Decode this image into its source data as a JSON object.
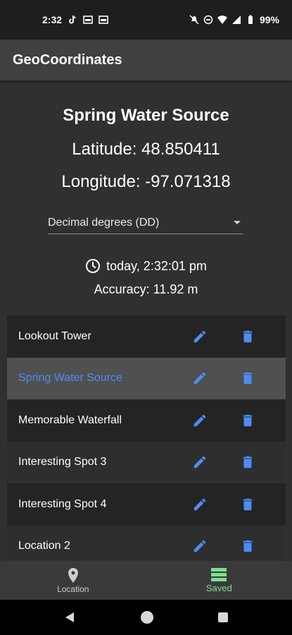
{
  "status_bar": {
    "time": "2:32",
    "battery": "99%"
  },
  "app_bar": {
    "title": "GeoCoordinates"
  },
  "location": {
    "name": "Spring Water Source",
    "latitude": "Latitude: 48.850411",
    "longitude": "Longitude: -97.071318",
    "format": "Decimal degrees (DD)",
    "timestamp": "today, 2:32:01 pm",
    "accuracy": "Accuracy: 11.92 m"
  },
  "saved_list": [
    {
      "label": "Lookout Tower"
    },
    {
      "label": "Spring Water Source",
      "selected": true
    },
    {
      "label": "Memorable Waterfall"
    },
    {
      "label": "Interesting Spot 3"
    },
    {
      "label": "Interesting Spot 4"
    },
    {
      "label": "Location 2"
    }
  ],
  "bottom_nav": {
    "location": "Location",
    "saved": "Saved"
  },
  "colors": {
    "accent_blue": "#4d8cf5",
    "active_green": "#7ee08e",
    "background": "#303030"
  },
  "icons": [
    "tiktok-icon",
    "calendar-icon",
    "mute-icon",
    "dnd-icon",
    "wifi-icon",
    "signal-icon",
    "battery-icon",
    "clock-icon",
    "edit-icon",
    "delete-icon",
    "location-pin-icon",
    "list-icon",
    "back-icon",
    "home-icon",
    "recents-icon"
  ]
}
